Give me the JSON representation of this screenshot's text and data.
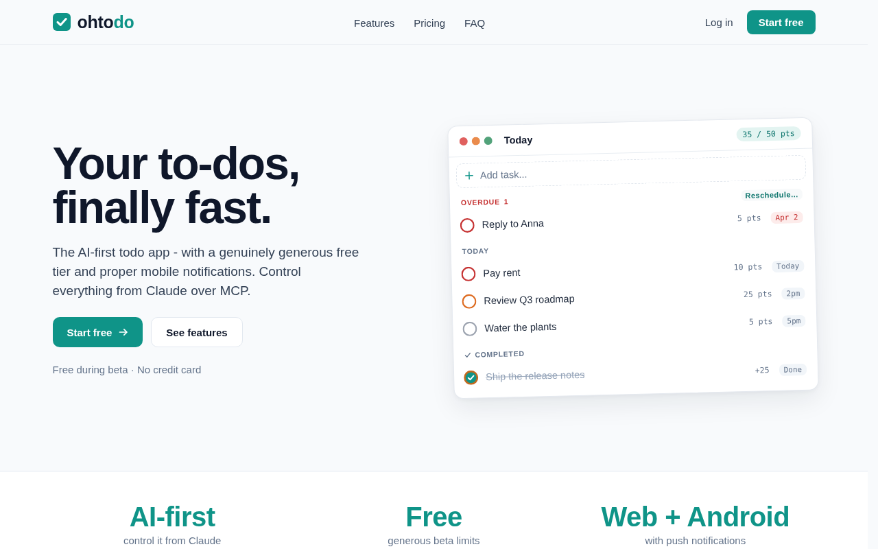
{
  "nav": {
    "logo": [
      {
        "text": "ohto",
        "accent": false
      },
      {
        "text": "do",
        "accent": true
      }
    ],
    "links": [
      "Features",
      "Pricing",
      "FAQ"
    ],
    "login": "Log in",
    "cta": "Start free"
  },
  "hero": {
    "title": "Your to-dos, finally fast.",
    "description": "The AI-first todo app - with a genuinely generous free tier and proper mobile notifications. Control everything from Claude over MCP.",
    "buttons": [
      {
        "label": "Start free",
        "kind": "primary"
      },
      {
        "label": "See features",
        "kind": "secondary"
      }
    ],
    "note": "Free during beta · No credit card"
  },
  "preview": {
    "title": "Today",
    "points": "35 / 50 pts",
    "add_task": {
      "placeholder": "Add task..."
    },
    "sections": [
      {
        "kind": "overdue",
        "title": "OVERDUE",
        "count": "1",
        "action": "Reschedule...",
        "tasks": [
          {
            "title": "Reply to Anna",
            "points": "5 pts",
            "due": "Apr 2",
            "checked": false,
            "color": "#c53030"
          }
        ]
      },
      {
        "kind": "today",
        "title": "TODAY",
        "tasks": [
          {
            "title": "Pay rent",
            "points": "10 pts",
            "due": "Today",
            "checked": false,
            "color": "#c53030"
          },
          {
            "title": "Review Q3 roadmap",
            "points": "25 pts",
            "due": "2pm",
            "checked": false,
            "color": "#dd6b20"
          },
          {
            "title": "Water the plants",
            "points": "5 pts",
            "due": "5pm",
            "checked": false,
            "color": "#9ca3af"
          }
        ]
      },
      {
        "kind": "completed",
        "title": "COMPLETED",
        "tasks": [
          {
            "title": "Ship the release notes",
            "points": "+25",
            "due": "Done",
            "checked": true,
            "color": "#c2691f"
          }
        ]
      }
    ]
  },
  "highlights": [
    {
      "title": "AI-first",
      "subtitle": "control it from Claude"
    },
    {
      "title": "Free",
      "subtitle": "generous beta limits"
    },
    {
      "title": "Web + Android",
      "subtitle": "with push notifications"
    }
  ]
}
